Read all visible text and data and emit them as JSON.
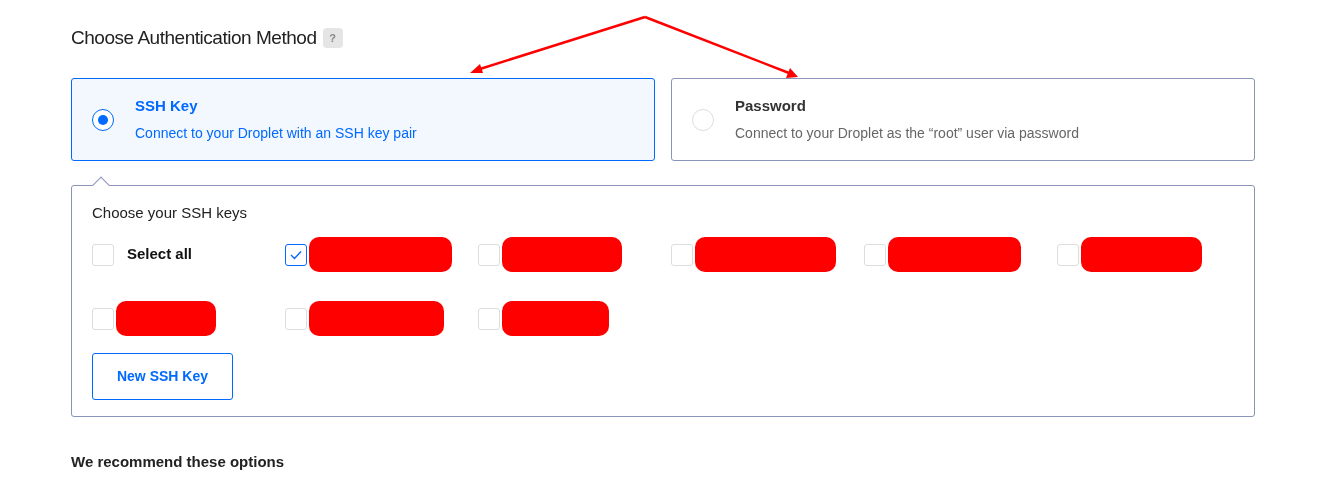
{
  "heading": {
    "title": "Choose Authentication Method",
    "help": "?"
  },
  "methods": [
    {
      "title": "SSH Key",
      "description": "Connect to your Droplet with an SSH key pair",
      "selected": true
    },
    {
      "title": "Password",
      "description": "Connect to your Droplet as the “root” user via password",
      "selected": false
    }
  ],
  "ssh_keys": {
    "title": "Choose your SSH keys",
    "items": [
      {
        "kind": "select_all",
        "label": "Select all",
        "checked": false
      },
      {
        "kind": "redacted",
        "checked": true
      },
      {
        "kind": "redacted",
        "checked": false
      },
      {
        "kind": "redacted",
        "checked": false
      },
      {
        "kind": "redacted",
        "checked": false
      },
      {
        "kind": "redacted",
        "checked": false
      },
      {
        "kind": "redacted",
        "checked": false
      },
      {
        "kind": "redacted",
        "checked": false
      },
      {
        "kind": "redacted",
        "checked": false
      }
    ],
    "button": "New SSH Key"
  },
  "footer_heading": "We recommend these options"
}
